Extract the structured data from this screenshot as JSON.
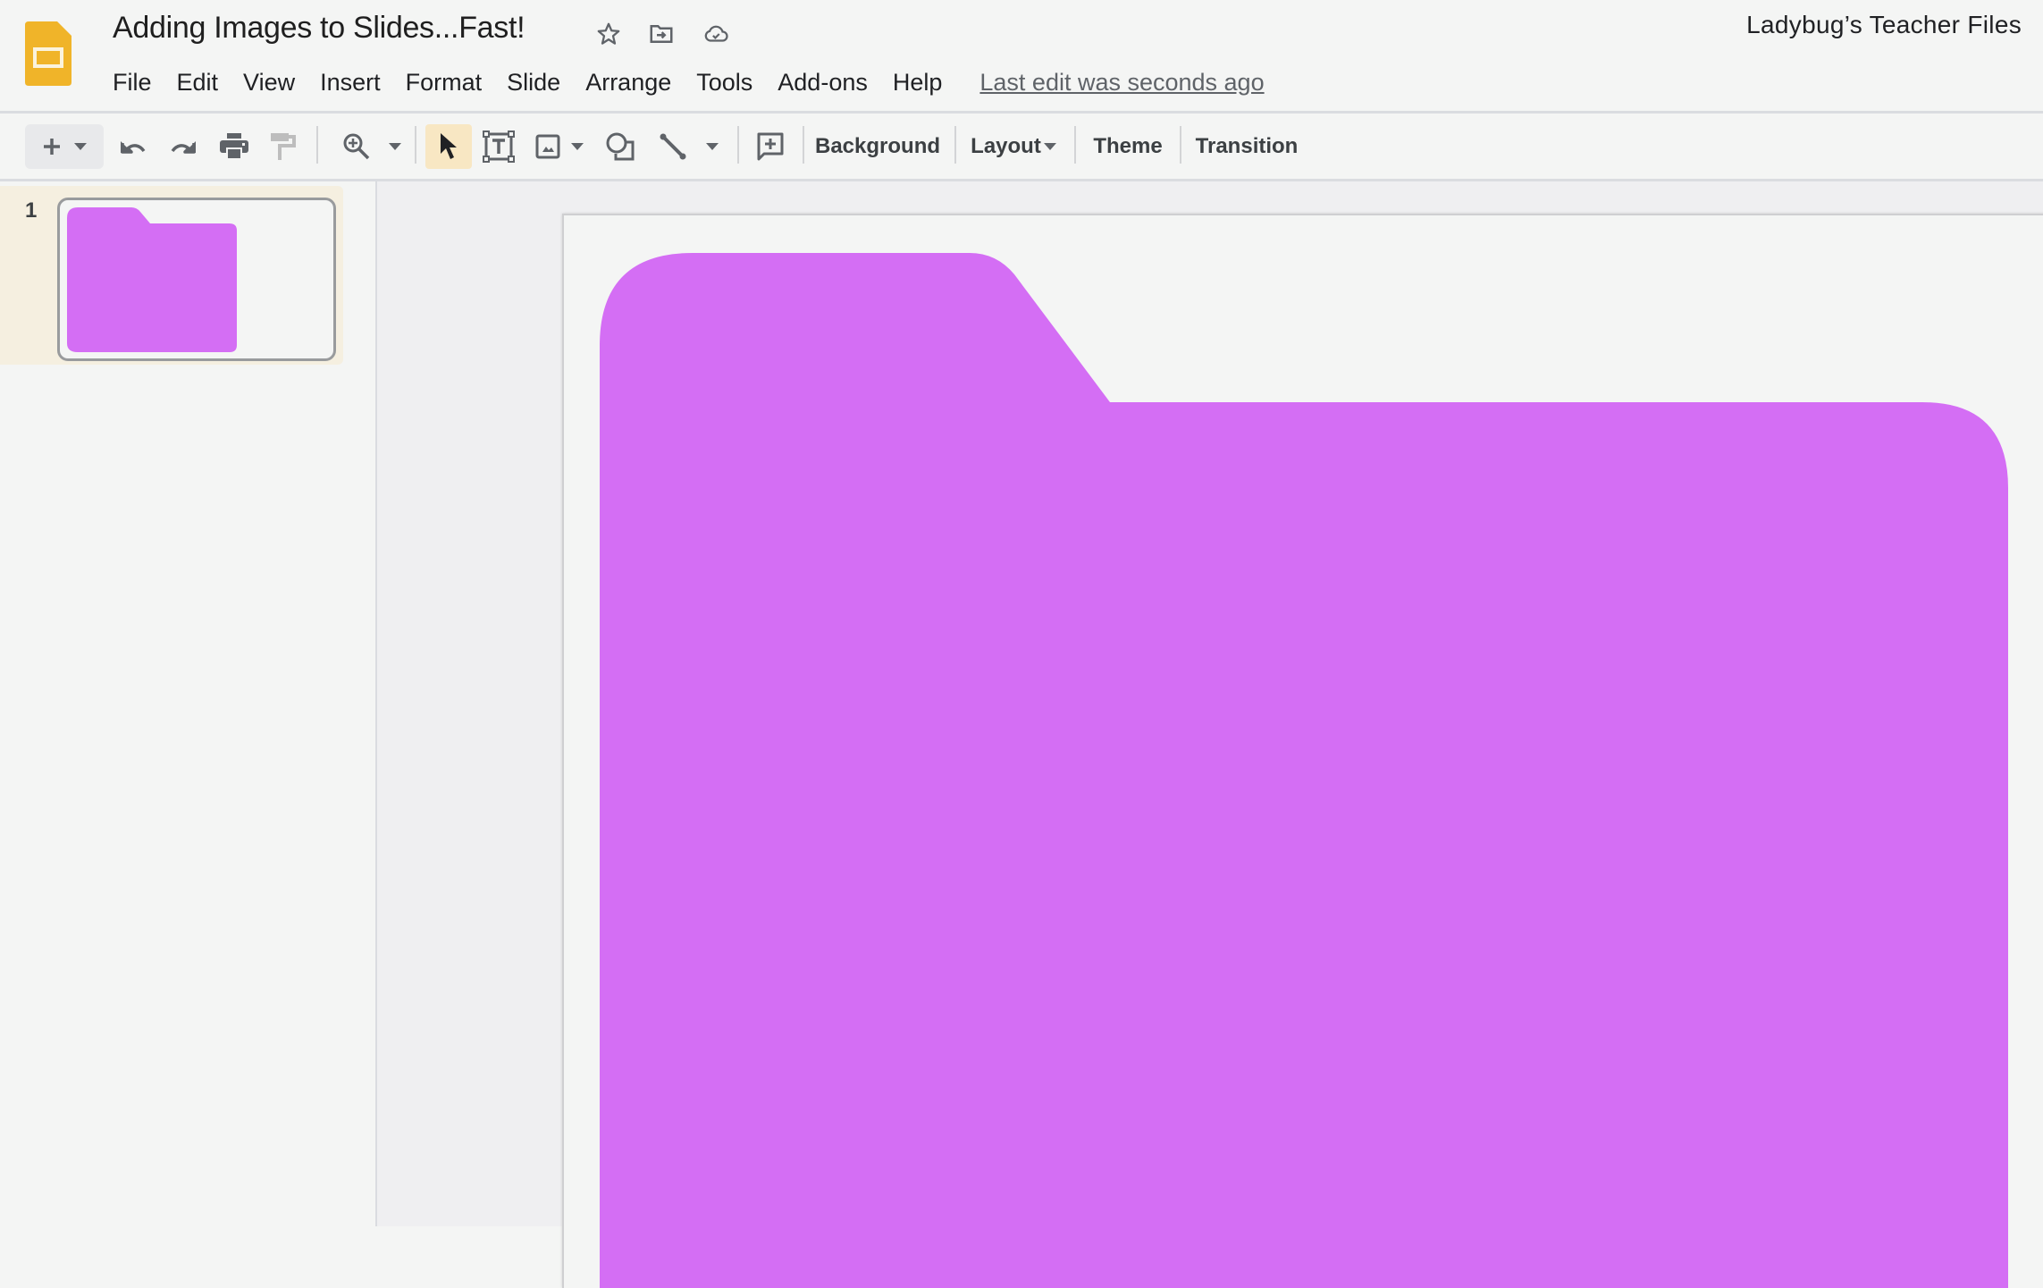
{
  "app": {
    "name": "Google Slides",
    "logo_icon": "slides-logo-icon",
    "document_title": "Adding Images to Slides...Fast!",
    "title_icons": [
      "star-icon",
      "move-to-folder-icon",
      "cloud-saved-icon"
    ],
    "account_name": "Ladybug’s Teacher Files"
  },
  "menubar": {
    "items": [
      "File",
      "Edit",
      "View",
      "Insert",
      "Format",
      "Slide",
      "Arrange",
      "Tools",
      "Add-ons",
      "Help"
    ],
    "last_edit": "Last edit was seconds ago"
  },
  "toolbar": {
    "icons": [
      "new-slide-icon",
      "dropdown-arrow-icon",
      "undo-icon",
      "redo-icon",
      "print-icon",
      "paint-format-icon",
      "zoom-icon",
      "dropdown-arrow-icon",
      "select-cursor-icon",
      "text-box-icon",
      "image-icon",
      "dropdown-arrow-icon",
      "shape-icon",
      "line-icon",
      "dropdown-arrow-icon",
      "add-comment-icon"
    ],
    "background_label": "Background",
    "layout_label": "Layout",
    "theme_label": "Theme",
    "transition_label": "Transition",
    "active_tool": "select"
  },
  "filmstrip": {
    "slides": [
      {
        "number": "1",
        "selected": true,
        "content": "purple folder shape"
      }
    ]
  },
  "slide": {
    "shape": "folder",
    "shape_color": "#d46ef4",
    "background_color": "#f4f5f4"
  },
  "colors": {
    "logo_yellow": "#f0b429",
    "selected_tool_bg": "#f8e7c3",
    "selected_thumb_bg": "#f5efe0",
    "canvas_gray": "#efeff1"
  }
}
